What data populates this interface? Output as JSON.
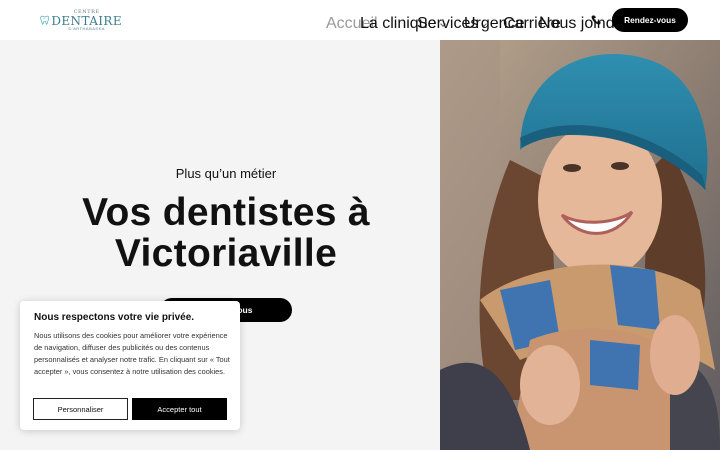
{
  "logo": {
    "line1": "CENTRE",
    "line2": "DENTAIRE",
    "line3": "D'ARTHABASKA"
  },
  "nav": {
    "items": [
      {
        "label": "Accueil",
        "active": true
      },
      {
        "label": "La clinique",
        "dropdown": true
      },
      {
        "label": "Services",
        "dropdown": true
      },
      {
        "label": "Urgence"
      },
      {
        "label": "Carrière"
      },
      {
        "label": "Nous joindre"
      }
    ],
    "phone_icon": "phone-icon",
    "cta_label": "Rendez-vous"
  },
  "hero": {
    "subtitle": "Plus qu’un métier",
    "title_line1": "Vos dentistes à",
    "title_line2": "Victoriaville",
    "button_label": "Rendez-vous"
  },
  "cookie": {
    "title": "Nous respectons votre vie privée.",
    "text": "Nous utilisons des cookies pour améliorer votre expérience de navigation, diffuser des publicités ou des contenus personnalisés et analyser notre trafic. En cliquant sur « Tout accepter », vous consentez à notre utilisation des cookies.",
    "customize_label": "Personnaliser",
    "accept_label": "Accepter tout"
  },
  "colors": {
    "accent": "#000000",
    "logo": "#3d7d8e",
    "hero_bg": "#f4f4f4"
  }
}
